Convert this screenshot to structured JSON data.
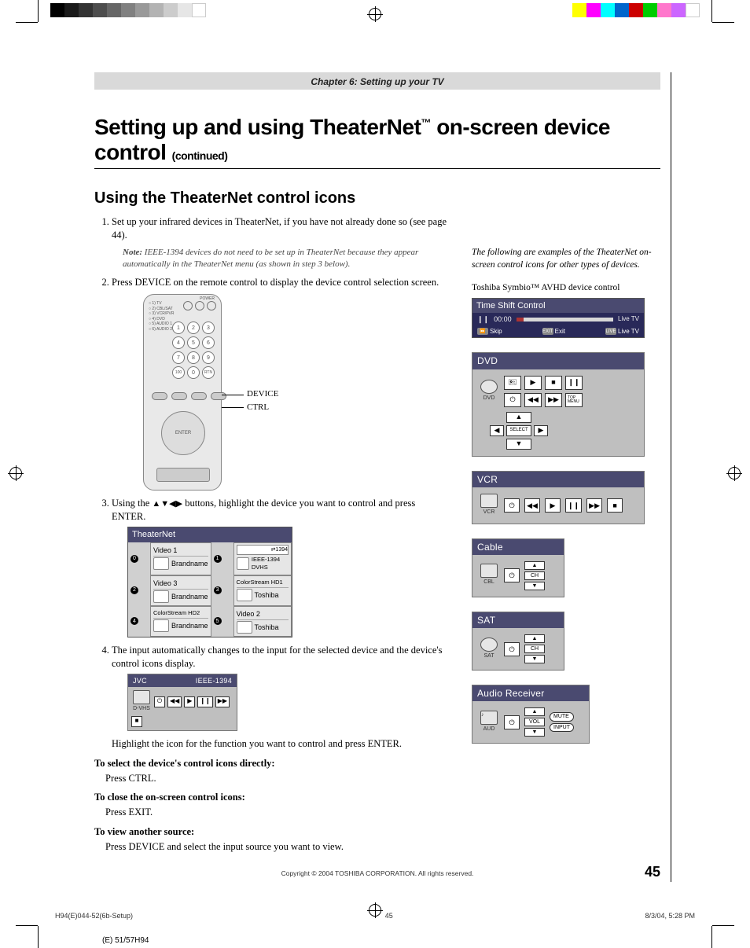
{
  "chapter_bar": "Chapter 6: Setting up your TV",
  "h1_a": "Setting up and using TheaterNet",
  "h1_sup": "™",
  "h1_b": " on-screen device control ",
  "h1_cont": "(continued)",
  "h2": "Using the TheaterNet control icons",
  "steps": {
    "s1": "Set up your infrared devices in TheaterNet, if you have not already done so (see page 44).",
    "note_label": "Note:",
    "note_body": " IEEE-1394 devices do not need to be set up in TheaterNet because they appear automatically in the TheaterNet menu (as shown in step 3 below).",
    "s2": "Press DEVICE on the remote control to display the device control selection screen.",
    "s3a": "Using the ",
    "s3_arrows": "▲▼◀▶",
    "s3b": " buttons, highlight the device you want to control and press ENTER.",
    "s4": "The input automatically changes to the input for the selected device and the device's control icons display.",
    "s4b": "Highlight the icon for the function you want to control and press ENTER."
  },
  "remote_labels": {
    "device": "DEVICE",
    "ctrl": "CTRL",
    "enter": "ENTER",
    "power": "POWER",
    "switches": "○ 1) TV\n○ 2) CBL/SAT\n○ 3) VCR/PVR\n○ 4) DVD\n○ 5) AUDIO 1\n○ 6) AUDIO 2"
  },
  "theaternet_table": {
    "title": "TheaterNet",
    "rows": [
      [
        {
          "num": "0",
          "icon": "CBL",
          "top": "Video 1",
          "bot": "Brandname"
        },
        {
          "num": "1",
          "icon": "D-VHS",
          "top": "⇄1394",
          "bot": "IEEE-1394 DVHS"
        }
      ],
      [
        {
          "num": "2",
          "icon": "PVR",
          "top": "Video 3",
          "bot": "Brandname"
        },
        {
          "num": "3",
          "icon": "SAT",
          "top": "ColorStream HD1",
          "bot": "Toshiba"
        }
      ],
      [
        {
          "num": "4",
          "icon": "",
          "top": "ColorStream HD2",
          "bot": "Brandname"
        },
        {
          "num": "5",
          "icon": "VCR",
          "top": "Video 2",
          "bot": "Toshiba"
        }
      ]
    ]
  },
  "jvc_panel": {
    "left": "JVC",
    "right": "IEEE-1394",
    "icon": "D-VHS",
    "buttons": [
      "⏻",
      "◀◀",
      "▶",
      "❙❙",
      "▶▶",
      "■"
    ]
  },
  "sub": {
    "sel_t": "To select the device's control icons directly:",
    "sel_b": "Press CTRL.",
    "close_t": "To close the on-screen control icons:",
    "close_b": "Press EXIT.",
    "view_t": "To view another source:",
    "view_b": "Press DEVICE and select the input source you want to view."
  },
  "right_intro": "The following are examples of the TheaterNet on-screen control icons for other types of devices.",
  "symbio_label": "Toshiba Symbio™ AVHD device control",
  "timeshift": {
    "title": "Time Shift Control",
    "time": "00:00",
    "live": "Live TV",
    "skip": "Skip",
    "exit_key": "EXIT",
    "exit": "Exit",
    "live_key": "LIVE",
    "live2": "Live TV"
  },
  "panels": {
    "dvd": {
      "title": "DVD",
      "icon": "DVD",
      "grid": [
        "🖭",
        "▶",
        "■",
        "❙❙",
        "⏻",
        "◀◀",
        "▶▶",
        "TOP MENU"
      ],
      "nav": [
        "▲",
        "◀",
        "SELECT",
        "▶",
        "▼"
      ]
    },
    "vcr": {
      "title": "VCR",
      "icon": "VCR",
      "buttons": [
        "⏻",
        "◀◀",
        "▶",
        "❙❙",
        "▶▶",
        "■"
      ]
    },
    "cable": {
      "title": "Cable",
      "icon": "CBL",
      "power": "⏻",
      "ch": [
        "▲",
        "CH",
        "▼"
      ]
    },
    "sat": {
      "title": "SAT",
      "icon": "SAT",
      "power": "⏻",
      "ch": [
        "▲",
        "CH",
        "▼"
      ]
    },
    "audio": {
      "title": "Audio Receiver",
      "icon": "AUD",
      "power": "⏻",
      "vol": [
        "▲",
        "VOL",
        "▼"
      ],
      "side": [
        "MUTE",
        "INPUT"
      ]
    }
  },
  "copyright": "Copyright © 2004 TOSHIBA CORPORATION. All rights reserved.",
  "page_num": "45",
  "footer": {
    "left": "H94(E)044-52(6b-Setup)",
    "mid": "45",
    "right": "8/3/04, 5:28 PM"
  },
  "footer_extra": "(E) 51/57H94"
}
